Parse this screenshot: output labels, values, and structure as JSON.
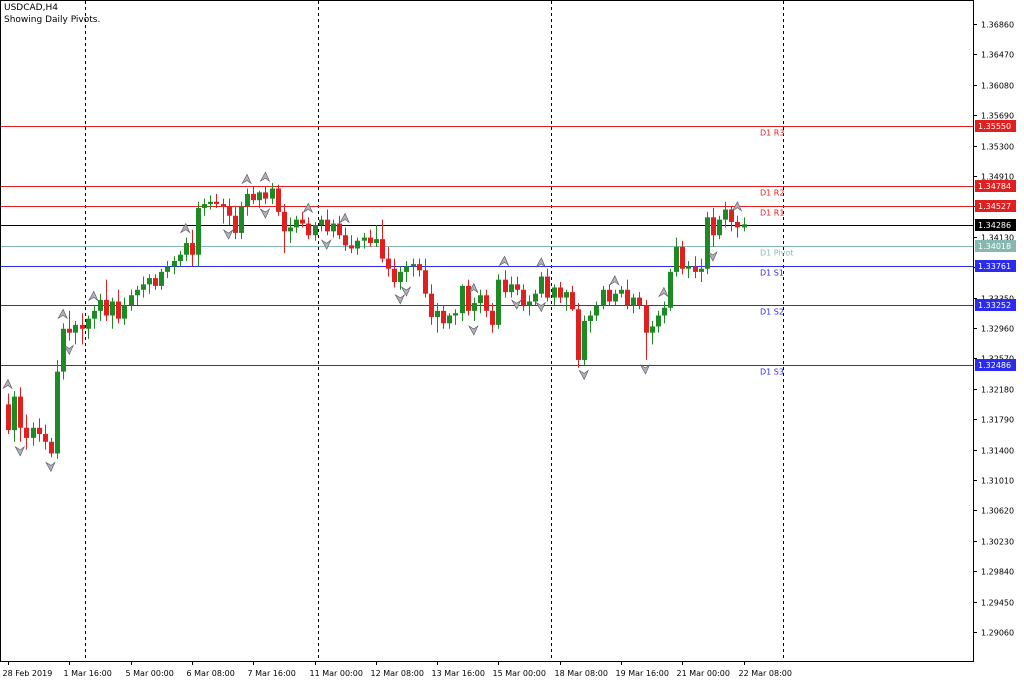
{
  "header": {
    "symbol_timeframe": "USDCAD,H4",
    "subtitle": "Showing Daily Pivots."
  },
  "colors": {
    "background": "#ffffff",
    "bull": "#1d8a24",
    "bear": "#e02020",
    "resistance": "#e02020",
    "support": "#2a2af0",
    "pivot": "#86b7b0",
    "current_price": "#000000",
    "grid": "#000000",
    "arrow": "#8a8a99"
  },
  "chart_data": {
    "type": "candlestick",
    "ylim": [
      1.2867,
      1.3725
    ],
    "y_ticks": [
      "1.36860",
      "1.36470",
      "1.36080",
      "1.35690",
      "1.35300",
      "1.34910",
      "1.34520",
      "1.34130",
      "1.33740",
      "1.33350",
      "1.32960",
      "1.32570",
      "1.32180",
      "1.31790",
      "1.31400",
      "1.31010",
      "1.30620",
      "1.30230",
      "1.29840",
      "1.29450",
      "1.29060"
    ],
    "x_labels": [
      {
        "i": 0,
        "label": "28 Feb 2019"
      },
      {
        "i": 10,
        "label": "1 Mar 16:00"
      },
      {
        "i": 20,
        "label": "5 Mar 00:00"
      },
      {
        "i": 30,
        "label": "6 Mar 08:00"
      },
      {
        "i": 40,
        "label": "7 Mar 16:00"
      },
      {
        "i": 50,
        "label": "11 Mar 00:00"
      },
      {
        "i": 60,
        "label": "12 Mar 08:00"
      },
      {
        "i": 70,
        "label": "13 Mar 16:00"
      },
      {
        "i": 80,
        "label": "15 Mar 00:00"
      },
      {
        "i": 90,
        "label": "18 Mar 08:00"
      },
      {
        "i": 100,
        "label": "19 Mar 16:00"
      },
      {
        "i": 110,
        "label": "21 Mar 00:00"
      },
      {
        "i": 120,
        "label": "22 Mar 08:00"
      }
    ],
    "period_separators": [
      12.5,
      50.5,
      88.5,
      126.5
    ],
    "pivot_levels": [
      {
        "name": "D1 R3",
        "value": 1.3555,
        "label": "1.35550",
        "kind": "resistance"
      },
      {
        "name": "D1 R2",
        "value": 1.34784,
        "label": "1.34784",
        "kind": "resistance"
      },
      {
        "name": "D1 R1",
        "value": 1.34527,
        "label": "1.34527",
        "kind": "resistance"
      },
      {
        "name": "D1 Pivot",
        "value": 1.34018,
        "label": "1.34018",
        "kind": "pivot"
      },
      {
        "name": "D1 S1",
        "value": 1.33761,
        "label": "1.33761",
        "kind": "support"
      },
      {
        "name": "D1 S2",
        "value": 1.33252,
        "label": "1.33252",
        "kind": "support"
      },
      {
        "name": "D1 S3",
        "value": 1.32486,
        "label": "1.32486",
        "kind": "support"
      }
    ],
    "current_price": {
      "value": 1.34286,
      "label": "1.34286"
    },
    "candles": [
      [
        1.3198,
        1.3212,
        1.316,
        1.3165
      ],
      [
        1.3165,
        1.3215,
        1.315,
        1.3208
      ],
      [
        1.3208,
        1.322,
        1.315,
        1.3168
      ],
      [
        1.3168,
        1.3185,
        1.314,
        1.3155
      ],
      [
        1.3155,
        1.3175,
        1.3145,
        1.3168
      ],
      [
        1.3168,
        1.318,
        1.315,
        1.316
      ],
      [
        1.316,
        1.3172,
        1.314,
        1.315
      ],
      [
        1.315,
        1.3155,
        1.313,
        1.3135
      ],
      [
        1.3135,
        1.3255,
        1.3128,
        1.324
      ],
      [
        1.324,
        1.3302,
        1.323,
        1.3295
      ],
      [
        1.3295,
        1.3318,
        1.328,
        1.329
      ],
      [
        1.329,
        1.3305,
        1.3275,
        1.33
      ],
      [
        1.33,
        1.3315,
        1.3275,
        1.3295
      ],
      [
        1.3295,
        1.3312,
        1.3282,
        1.3308
      ],
      [
        1.3308,
        1.3325,
        1.3295,
        1.3318
      ],
      [
        1.3318,
        1.334,
        1.3305,
        1.3332
      ],
      [
        1.3332,
        1.3358,
        1.3305,
        1.3312
      ],
      [
        1.3312,
        1.3335,
        1.3295,
        1.333
      ],
      [
        1.333,
        1.3345,
        1.3302,
        1.3308
      ],
      [
        1.3308,
        1.3335,
        1.33,
        1.3325
      ],
      [
        1.3325,
        1.3345,
        1.3318,
        1.3338
      ],
      [
        1.3338,
        1.335,
        1.3325,
        1.3345
      ],
      [
        1.3345,
        1.3362,
        1.3335,
        1.3352
      ],
      [
        1.3352,
        1.3365,
        1.334,
        1.336
      ],
      [
        1.336,
        1.3365,
        1.3345,
        1.335
      ],
      [
        1.335,
        1.3372,
        1.3345,
        1.3368
      ],
      [
        1.3368,
        1.3382,
        1.336,
        1.3375
      ],
      [
        1.3375,
        1.3388,
        1.3365,
        1.3382
      ],
      [
        1.3382,
        1.3395,
        1.3375,
        1.339
      ],
      [
        1.339,
        1.3412,
        1.3382,
        1.3405
      ],
      [
        1.3405,
        1.3422,
        1.3375,
        1.339
      ],
      [
        1.339,
        1.3458,
        1.3375,
        1.345
      ],
      [
        1.345,
        1.3462,
        1.344,
        1.3455
      ],
      [
        1.3455,
        1.3466,
        1.3448,
        1.3458
      ],
      [
        1.3458,
        1.3468,
        1.345,
        1.3455
      ],
      [
        1.3455,
        1.3462,
        1.343,
        1.3452
      ],
      [
        1.3452,
        1.3462,
        1.3428,
        1.344
      ],
      [
        1.344,
        1.3452,
        1.341,
        1.3418
      ],
      [
        1.3418,
        1.3458,
        1.341,
        1.3452
      ],
      [
        1.3452,
        1.3475,
        1.344,
        1.3468
      ],
      [
        1.3468,
        1.3478,
        1.3455,
        1.346
      ],
      [
        1.346,
        1.3472,
        1.345,
        1.347
      ],
      [
        1.347,
        1.3478,
        1.3455,
        1.3462
      ],
      [
        1.3462,
        1.3482,
        1.3455,
        1.3475
      ],
      [
        1.3475,
        1.348,
        1.344,
        1.3445
      ],
      [
        1.3445,
        1.3455,
        1.3392,
        1.342
      ],
      [
        1.342,
        1.3438,
        1.3405,
        1.3425
      ],
      [
        1.3425,
        1.344,
        1.3418,
        1.3435
      ],
      [
        1.3435,
        1.3445,
        1.3425,
        1.343
      ],
      [
        1.343,
        1.3438,
        1.341,
        1.3415
      ],
      [
        1.3415,
        1.3432,
        1.3408,
        1.3428
      ],
      [
        1.3428,
        1.344,
        1.342,
        1.3435
      ],
      [
        1.3435,
        1.3448,
        1.3415,
        1.342
      ],
      [
        1.342,
        1.3435,
        1.3412,
        1.343
      ],
      [
        1.343,
        1.344,
        1.341,
        1.3415
      ],
      [
        1.3415,
        1.3425,
        1.3395,
        1.3402
      ],
      [
        1.3402,
        1.3415,
        1.3392,
        1.3398
      ],
      [
        1.3398,
        1.3412,
        1.339,
        1.3408
      ],
      [
        1.3408,
        1.3418,
        1.3398,
        1.3412
      ],
      [
        1.3412,
        1.3422,
        1.34,
        1.3405
      ],
      [
        1.3405,
        1.3428,
        1.34,
        1.341
      ],
      [
        1.341,
        1.3435,
        1.338,
        1.3385
      ],
      [
        1.3385,
        1.34,
        1.3362,
        1.3372
      ],
      [
        1.3372,
        1.3385,
        1.3348,
        1.3355
      ],
      [
        1.3355,
        1.3375,
        1.3345,
        1.3368
      ],
      [
        1.3368,
        1.3382,
        1.3355,
        1.3375
      ],
      [
        1.3375,
        1.3385,
        1.3362,
        1.3378
      ],
      [
        1.3378,
        1.3385,
        1.3362,
        1.337
      ],
      [
        1.337,
        1.3385,
        1.3335,
        1.334
      ],
      [
        1.334,
        1.3352,
        1.33,
        1.331
      ],
      [
        1.331,
        1.3328,
        1.329,
        1.3318
      ],
      [
        1.3318,
        1.3325,
        1.3295,
        1.3302
      ],
      [
        1.3302,
        1.3315,
        1.3295,
        1.3312
      ],
      [
        1.3312,
        1.332,
        1.33,
        1.3315
      ],
      [
        1.3315,
        1.3352,
        1.3305,
        1.335
      ],
      [
        1.335,
        1.3358,
        1.3312,
        1.3318
      ],
      [
        1.3318,
        1.3335,
        1.3305,
        1.3328
      ],
      [
        1.3328,
        1.3345,
        1.3315,
        1.3338
      ],
      [
        1.3338,
        1.3345,
        1.331,
        1.3318
      ],
      [
        1.3318,
        1.3328,
        1.329,
        1.33
      ],
      [
        1.33,
        1.3365,
        1.3295,
        1.3358
      ],
      [
        1.3358,
        1.337,
        1.3335,
        1.3342
      ],
      [
        1.3342,
        1.3362,
        1.3335,
        1.3352
      ],
      [
        1.3352,
        1.3362,
        1.3338,
        1.3345
      ],
      [
        1.3345,
        1.3352,
        1.3318,
        1.3325
      ],
      [
        1.3325,
        1.3338,
        1.3312,
        1.333
      ],
      [
        1.333,
        1.3345,
        1.3325,
        1.334
      ],
      [
        1.334,
        1.3368,
        1.3335,
        1.3362
      ],
      [
        1.3362,
        1.3372,
        1.333,
        1.3335
      ],
      [
        1.3335,
        1.3352,
        1.3325,
        1.3348
      ],
      [
        1.3348,
        1.3355,
        1.3328,
        1.3335
      ],
      [
        1.3335,
        1.3345,
        1.3318,
        1.3342
      ],
      [
        1.3342,
        1.335,
        1.3318,
        1.332
      ],
      [
        1.332,
        1.3328,
        1.3245,
        1.3255
      ],
      [
        1.3255,
        1.3312,
        1.3248,
        1.3305
      ],
      [
        1.3305,
        1.3318,
        1.329,
        1.3312
      ],
      [
        1.3312,
        1.333,
        1.3305,
        1.3325
      ],
      [
        1.3325,
        1.335,
        1.332,
        1.3345
      ],
      [
        1.3345,
        1.3352,
        1.3325,
        1.333
      ],
      [
        1.333,
        1.3345,
        1.3325,
        1.334
      ],
      [
        1.334,
        1.335,
        1.3335,
        1.3345
      ],
      [
        1.3345,
        1.3358,
        1.332,
        1.3325
      ],
      [
        1.3325,
        1.334,
        1.3315,
        1.3335
      ],
      [
        1.3335,
        1.3342,
        1.332,
        1.3325
      ],
      [
        1.3325,
        1.3332,
        1.3255,
        1.329
      ],
      [
        1.329,
        1.3305,
        1.3275,
        1.3298
      ],
      [
        1.3298,
        1.3318,
        1.329,
        1.3312
      ],
      [
        1.3312,
        1.333,
        1.3302,
        1.3322
      ],
      [
        1.3322,
        1.3372,
        1.3318,
        1.3368
      ],
      [
        1.3368,
        1.3412,
        1.3362,
        1.34
      ],
      [
        1.34,
        1.3408,
        1.3365,
        1.3372
      ],
      [
        1.3372,
        1.3382,
        1.336,
        1.3375
      ],
      [
        1.3375,
        1.3388,
        1.336,
        1.3368
      ],
      [
        1.3368,
        1.3385,
        1.3355,
        1.3372
      ],
      [
        1.3372,
        1.3445,
        1.3365,
        1.3438
      ],
      [
        1.3438,
        1.345,
        1.34,
        1.3415
      ],
      [
        1.3415,
        1.344,
        1.341,
        1.3435
      ],
      [
        1.3435,
        1.3458,
        1.3425,
        1.3448
      ],
      [
        1.3448,
        1.3452,
        1.342,
        1.3432
      ],
      [
        1.3432,
        1.344,
        1.3412,
        1.3425
      ],
      [
        1.3425,
        1.3438,
        1.342,
        1.3429
      ]
    ],
    "fractal_highs": [
      0,
      9,
      14,
      29,
      39,
      42,
      49,
      55,
      76,
      81,
      87,
      99,
      107,
      119
    ],
    "fractal_lows": [
      2,
      7,
      10,
      36,
      42,
      52,
      64,
      65,
      76,
      83,
      87,
      94,
      104,
      115
    ]
  }
}
